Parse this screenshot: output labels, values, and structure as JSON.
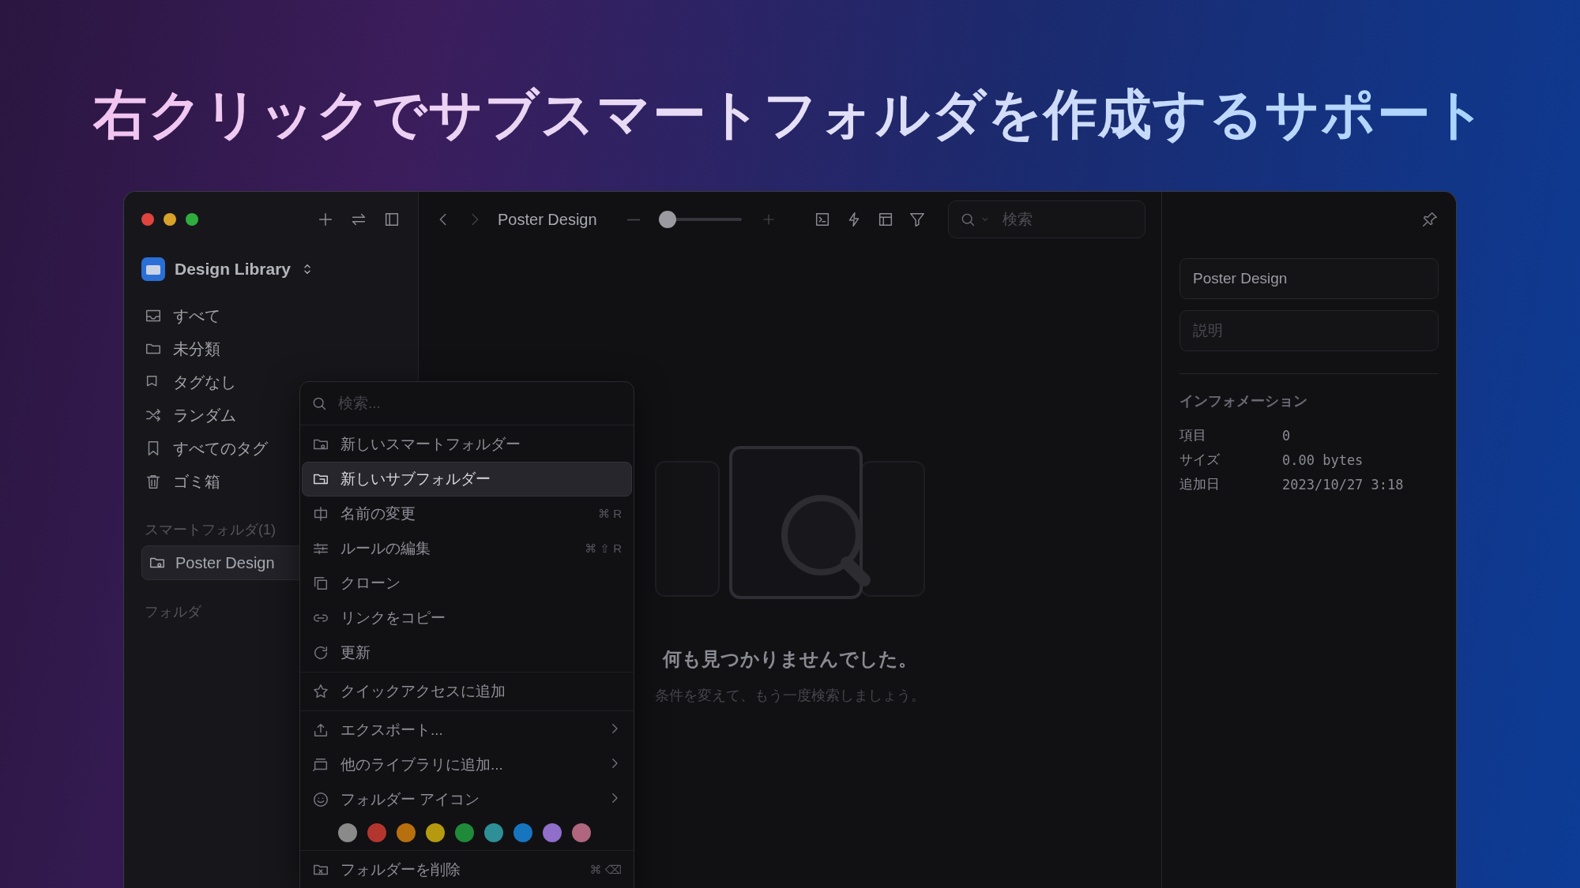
{
  "headline": "右クリックでサブスマートフォルダを作成するサポート",
  "sidebar": {
    "library": "Design Library",
    "items": [
      {
        "label": "すべて"
      },
      {
        "label": "未分類"
      },
      {
        "label": "タグなし"
      },
      {
        "label": "ランダム"
      },
      {
        "label": "すべてのタグ"
      },
      {
        "label": "ゴミ箱"
      }
    ],
    "smart_folders_heading": "スマートフォルダ(1)",
    "smart_folders": [
      {
        "label": "Poster Design",
        "selected": true
      }
    ],
    "folders_heading": "フォルダ"
  },
  "toolbar": {
    "title": "Poster Design",
    "zoom": {
      "level": 0.1
    },
    "search_placeholder": "検索"
  },
  "empty_state": {
    "title": "何も見つかりませんでした。",
    "subtitle": "条件を変えて、もう一度検索しましょう。"
  },
  "inspector": {
    "name": "Poster Design",
    "description_placeholder": "説明",
    "info_heading": "インフォメーション",
    "info": [
      {
        "label": "項目",
        "value": "0"
      },
      {
        "label": "サイズ",
        "value": "0.00 bytes"
      },
      {
        "label": "追加日",
        "value": "2023/10/27 3:18"
      }
    ]
  },
  "context_menu": {
    "search_placeholder": "検索...",
    "groups": [
      [
        {
          "label": "新しいスマートフォルダー",
          "selected": false
        },
        {
          "label": "新しいサブフォルダー",
          "selected": true
        },
        {
          "label": "名前の変更",
          "shortcut": "⌘ R",
          "selected": false
        },
        {
          "label": "ルールの編集",
          "shortcut": "⌘ ⇧ R",
          "selected": false
        },
        {
          "label": "クローン",
          "selected": false
        },
        {
          "label": "リンクをコピー",
          "selected": false
        },
        {
          "label": "更新",
          "selected": false
        }
      ],
      [
        {
          "label": "クイックアクセスに追加",
          "selected": false
        }
      ],
      [
        {
          "label": "エクスポート...",
          "submenu": true,
          "selected": false
        },
        {
          "label": "他のライブラリに追加...",
          "submenu": true,
          "selected": false
        },
        {
          "label": "フォルダー アイコン",
          "submenu": true,
          "selected": false
        }
      ],
      [
        {
          "label": "フォルダーを削除",
          "shortcut": "⌘ ⌫",
          "selected": false
        }
      ]
    ],
    "colors": [
      {
        "color": "#8a8a8a"
      },
      {
        "color": "#b3362e"
      },
      {
        "color": "#b8700e"
      },
      {
        "color": "#b59a10"
      },
      {
        "color": "#1f8a3a"
      },
      {
        "color": "#2f8f97"
      },
      {
        "color": "#1775c0"
      },
      {
        "color": "#8f6fc9"
      },
      {
        "color": "#b0667e"
      }
    ]
  }
}
